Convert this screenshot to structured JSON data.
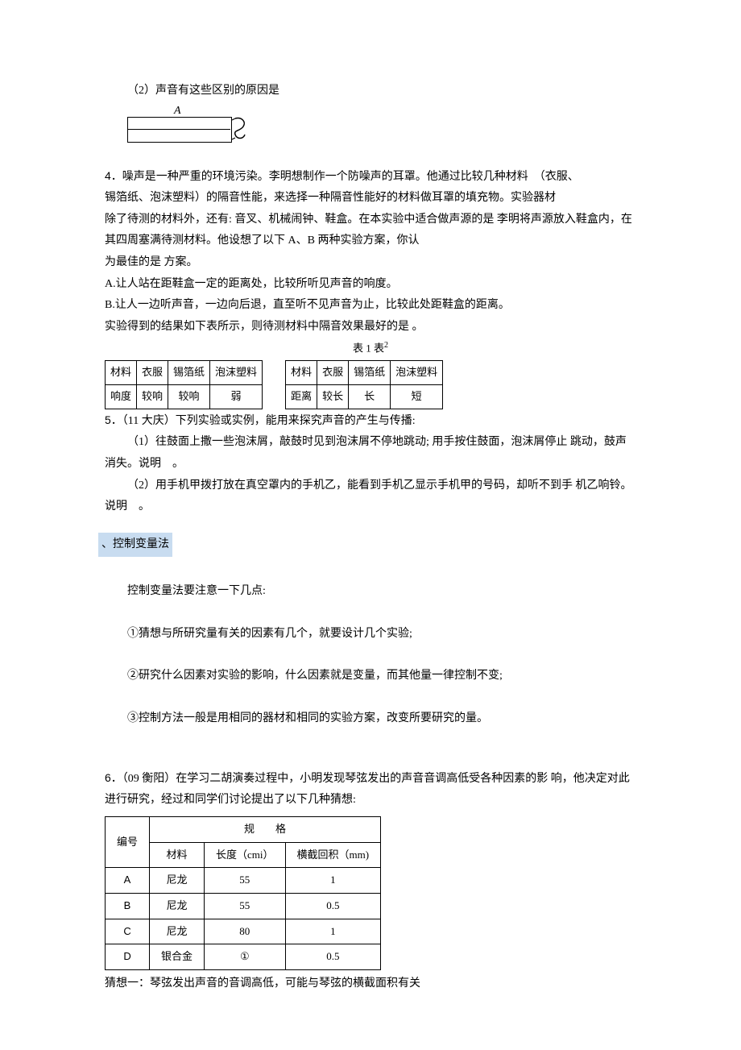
{
  "q2_part2": "（2）声音有这些区别的原因是",
  "diagram_label_A": "A",
  "q4": {
    "num": "4",
    "l1": "．噪声是一种严重的环境污染。李明想制作一个防噪声的耳罩。他通过比较几种材料　（衣服、",
    "l2": "锡箔纸、泡沫塑料）的隔音性能，来选择一种隔音性能好的材料做耳罩的填充物。实验器材",
    "l3": "除了待测的材料外，还有: 音叉、机械闹钟、鞋盒。在本实验中适合做声源的是  李明将声源放入鞋盒内，在其四周塞满待测材料。他设想了以下 A、B 两种实验方案，你认",
    "l4": "为最佳的是  方案。",
    "optA": "A.让人站在距鞋盒一定的距离处，比较所听见声音的响度。",
    "optB": "B.让人一边听声音，一边向后退，直至听不见声音为止，比较此处距鞋盒的距离。",
    "l5": "实验得到的结果如下表所示，则待测材料中隔音效果最好的是 。",
    "caption": "表 1 表",
    "sup": "2",
    "t1": {
      "h": [
        "材料",
        "衣服",
        "锡箔纸",
        "泡沫塑料"
      ],
      "r": [
        "响度",
        "较响",
        "较响",
        "弱"
      ]
    },
    "t2": {
      "h": [
        "材料",
        "衣服",
        "锡箔纸",
        "泡沫塑料"
      ],
      "r": [
        "距离",
        "较长",
        "长",
        "短"
      ]
    }
  },
  "q5": {
    "num": "5",
    "head": "．（11 大庆）下列实验或实例，能用来探究声音的产生与传播:",
    "p1": "（1）往鼓面上撒一些泡沫屑，敲鼓时见到泡沫屑不停地跳动; 用手按住鼓面，泡沫屑停止  跳动，鼓声消失。说明　。",
    "p2": "（2）用手机甲拨打放在真空罩内的手机乙，能看到手机乙显示手机甲的号码，却听不到手  机乙响铃。说明　。"
  },
  "section_label": "、控制变量法",
  "cv_intro": "控制变量法要注意一下几点:",
  "cv_1": "①猜想与所研究量有关的因素有几个，就要设计几个实验;",
  "cv_2": "②研究什么因素对实验的影响，什么因素就是变量，而其他量一律控制不变;",
  "cv_3": "③控制方法一般是用相同的器材和相同的实验方案，改变所要研究的量。",
  "q6": {
    "num": "6",
    "head": "．（09 衡阳）在学习二胡演奏过程中，小明发现琴弦发出的声音音调高低受各种因素的影  响，他决定对此进行研究，经过和同学们讨论提出了以下几种猜想:",
    "th_no": "编号",
    "th_spec": "规　　格",
    "th_mat": "材料",
    "th_len": "长度（cmi）",
    "th_area": "横截回积（mm)",
    "rows": [
      {
        "no": "A",
        "mat": "尼龙",
        "len": "55",
        "area": "1"
      },
      {
        "no": "B",
        "mat": "尼龙",
        "len": "55",
        "area": "0.5"
      },
      {
        "no": "C",
        "mat": "尼龙",
        "len": "80",
        "area": "1"
      },
      {
        "no": "D",
        "mat": "银合金",
        "len": "①",
        "area": "0.5"
      }
    ],
    "guess1": "猜想一：琴弦发出声音的音调高低，可能与琴弦的横截面积有关"
  }
}
